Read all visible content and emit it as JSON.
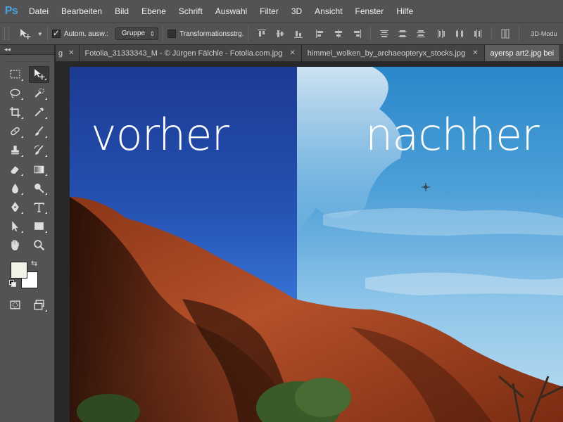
{
  "app": {
    "logo": "Ps"
  },
  "menu": {
    "items": [
      "Datei",
      "Bearbeiten",
      "Bild",
      "Ebene",
      "Schrift",
      "Auswahl",
      "Filter",
      "3D",
      "Ansicht",
      "Fenster",
      "Hilfe"
    ]
  },
  "options": {
    "auto_select_label": "Autom. ausw.:",
    "auto_select_checked": true,
    "auto_select_value": "Gruppe",
    "transform_label": "Transformationsstrg.",
    "transform_checked": false,
    "mode_3d_label": "3D-Modu"
  },
  "tools": {
    "collapse_glyph": "◂◂",
    "active_tool": "move-tool",
    "foreground_color": "#f3f2e6",
    "background_color": "#ffffff"
  },
  "tabs": [
    {
      "label": "g",
      "active": false
    },
    {
      "label": "Fotolia_31333343_M - © Jürgen Fälchle - Fotolia.com.jpg",
      "active": false
    },
    {
      "label": "himmel_wolken_by_archaeopteryx_stocks.jpg",
      "active": false
    },
    {
      "label": "ayersp art2.jpg bei",
      "active": true
    }
  ],
  "tab_close_glyph": "✕",
  "canvas": {
    "label_left": "vorher",
    "label_right": "nachher"
  },
  "colors": {
    "chrome": "#535353",
    "workspace": "#282828",
    "accent": "#4aa3df"
  }
}
